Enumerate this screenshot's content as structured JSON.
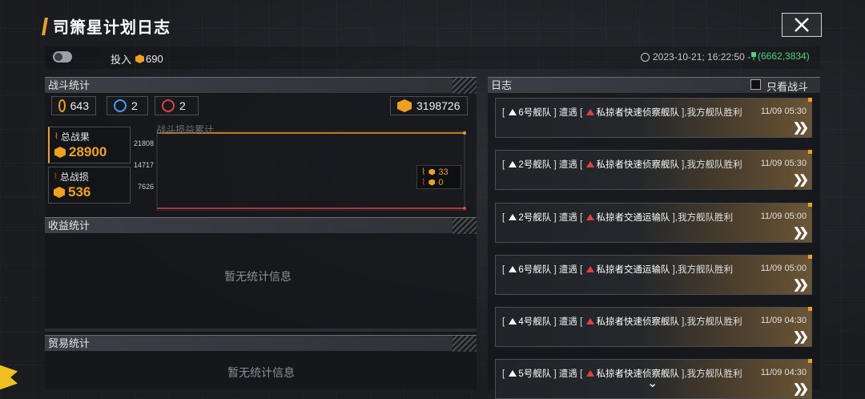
{
  "header": {
    "title": "司箫星计划日志",
    "invest_label": "投入",
    "invest_value": "690",
    "time": "2023-10-21; 16:22:50 -",
    "coords": "(6662,3834)"
  },
  "battle_stats": {
    "title": "战斗统计",
    "counters": [
      {
        "icon": "gold-coin-icon",
        "value": "643"
      },
      {
        "icon": "blue-swirl-icon",
        "value": "2"
      },
      {
        "icon": "red-bolt-icon",
        "value": "2"
      }
    ],
    "exp_value": "3198726",
    "total_result_label": "总战果",
    "total_result_value": "28900",
    "total_loss_label": "总战损",
    "total_loss_value": "536",
    "chart_title": "战斗损益累计",
    "legend_gain_value": "33",
    "legend_loss_value": "0"
  },
  "chart_data": {
    "type": "line",
    "title": "战斗损益累计",
    "y_ticks": [
      "21808",
      "14717",
      "7626"
    ],
    "series": [
      {
        "color": "#f0a020",
        "values": [
          28900,
          28900
        ]
      },
      {
        "color": "#e04040",
        "values": [
          536,
          536
        ]
      }
    ],
    "ylim": [
      536,
      28900
    ]
  },
  "income_stats": {
    "title": "收益统计",
    "empty_text": "暂无统计信息"
  },
  "trade_stats": {
    "title": "贸易统计",
    "empty_text": "暂无统计信息"
  },
  "log": {
    "title": "日志",
    "filter_label": "只看战斗",
    "items": [
      {
        "fleet": "6号舰队",
        "verb": "遭遇",
        "enemy": "私掠者快速侦察舰队",
        "result": ",我方舰队胜利",
        "time": "11/09 05:30"
      },
      {
        "fleet": "2号舰队",
        "verb": "遭遇",
        "enemy": "私掠者快速侦察舰队",
        "result": ",我方舰队胜利",
        "time": "11/09 05:30"
      },
      {
        "fleet": "2号舰队",
        "verb": "遭遇",
        "enemy": "私掠者交通运输队",
        "result": ",我方舰队胜利",
        "time": "11/09 05:00"
      },
      {
        "fleet": "6号舰队",
        "verb": "遭遇",
        "enemy": "私掠者交通运输队",
        "result": ",我方舰队胜利",
        "time": "11/09 05:00"
      },
      {
        "fleet": "4号舰队",
        "verb": "遭遇",
        "enemy": "私掠者快速侦察舰队",
        "result": ",我方舰队胜利",
        "time": "11/09 04:30"
      },
      {
        "fleet": "5号舰队",
        "verb": "遭遇",
        "enemy": "私掠者快速侦察舰队",
        "result": ",我方舰队胜利",
        "time": "11/09 04:30"
      }
    ]
  }
}
